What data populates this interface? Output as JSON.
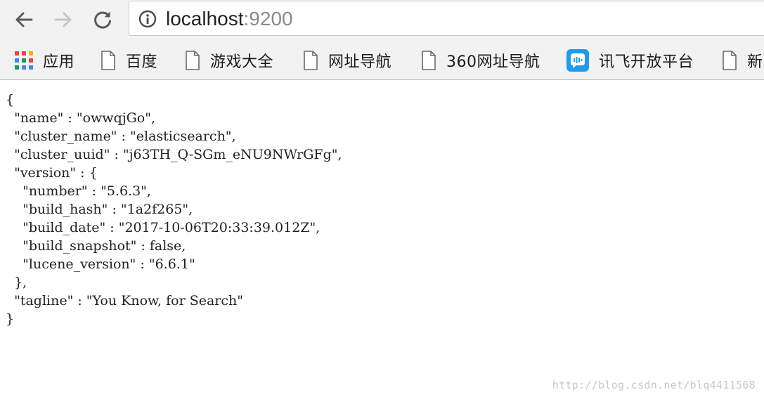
{
  "address_bar": {
    "host": "localhost",
    "port": ":9200"
  },
  "bookmarks": [
    {
      "label": "应用",
      "icon": "apps-grid-icon"
    },
    {
      "label": "百度",
      "icon": "page-icon"
    },
    {
      "label": "游戏大全",
      "icon": "page-icon"
    },
    {
      "label": "网址导航",
      "icon": "page-icon"
    },
    {
      "label": "360网址导航",
      "icon": "page-icon"
    },
    {
      "label": "讯飞开放平台",
      "icon": "xunfei-icon"
    },
    {
      "label": "新",
      "icon": "page-icon"
    }
  ],
  "json_lines": [
    "{",
    "  \"name\" : \"owwqjGo\",",
    "  \"cluster_name\" : \"elasticsearch\",",
    "  \"cluster_uuid\" : \"j63TH_Q-SGm_eNU9NWrGFg\",",
    "  \"version\" : {",
    "    \"number\" : \"5.6.3\",",
    "    \"build_hash\" : \"1a2f265\",",
    "    \"build_date\" : \"2017-10-06T20:33:39.012Z\",",
    "    \"build_snapshot\" : false,",
    "    \"lucene_version\" : \"6.6.1\"",
    "  },",
    "  \"tagline\" : \"You Know, for Search\"",
    "}"
  ],
  "watermark": "http://blog.csdn.net/blq4411568",
  "colors": {
    "toolbar_bg": "#f2f2f2",
    "url_host": "#222222",
    "url_port": "#8a8a8a",
    "xunfei_blue": "#1e9be9"
  }
}
